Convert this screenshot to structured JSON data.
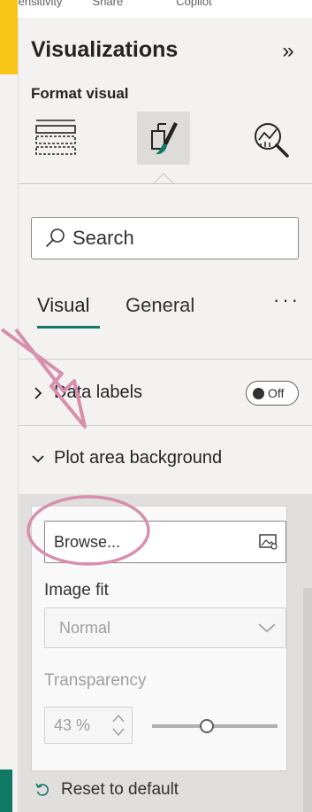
{
  "ribbon": {
    "cutoff_labels": [
      "Sensitivity",
      "Share",
      "Copilot"
    ]
  },
  "pane": {
    "title": "Visualizations",
    "collapse_glyph": "»",
    "format_label": "Format visual",
    "icons": [
      "build-visual-icon",
      "format-paintbrush-icon",
      "analytics-icon"
    ]
  },
  "search": {
    "placeholder": "Search"
  },
  "tabs": [
    {
      "label": "Visual",
      "selected": true
    },
    {
      "label": "General",
      "selected": false
    }
  ],
  "more_glyph": "···",
  "sections": {
    "data_labels": {
      "label": "Data labels",
      "toggle_text": "Off",
      "expanded": false
    },
    "plot_area": {
      "label": "Plot area background",
      "expanded": true
    }
  },
  "plot_area": {
    "browse_label": "Browse...",
    "image_fit_label": "Image fit",
    "image_fit_value": "Normal",
    "transparency_label": "Transparency",
    "transparency_value": "43 %",
    "transparency_level": 0.43
  },
  "reset_label": "Reset to default",
  "colors": {
    "highlight_yellow": "#f7c518",
    "accent_green": "#117865",
    "annotation_pink": "#d88fae"
  }
}
